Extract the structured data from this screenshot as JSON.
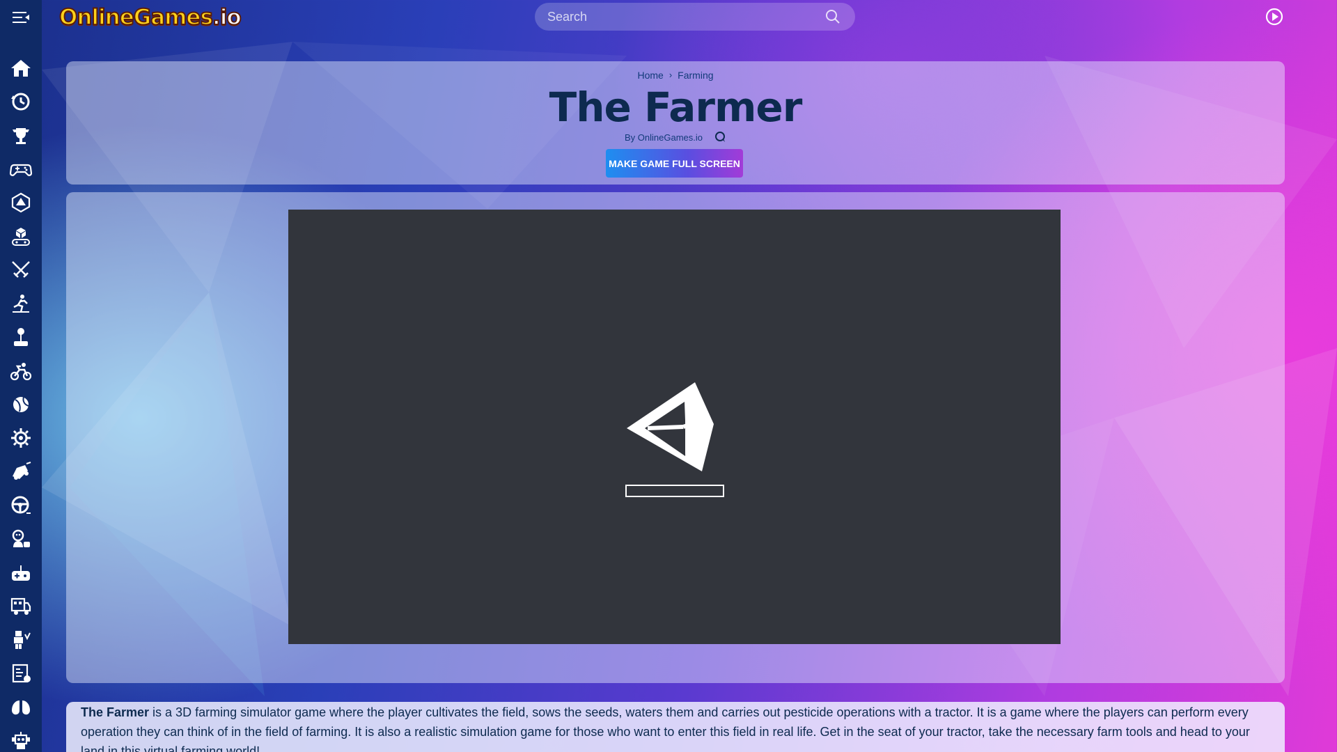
{
  "site": {
    "logo_main": "OnlineGames",
    "logo_suffix": ".io"
  },
  "search": {
    "placeholder": "Search",
    "value": ""
  },
  "sidebar": {
    "items": [
      {
        "icon": "home-icon"
      },
      {
        "icon": "history-icon"
      },
      {
        "icon": "trophy-icon"
      },
      {
        "icon": "gamepad-icon"
      },
      {
        "icon": "d20-icon"
      },
      {
        "icon": "joystick-cube-icon"
      },
      {
        "icon": "swords-icon"
      },
      {
        "icon": "stickman-icon"
      },
      {
        "icon": "arcade-stick-icon"
      },
      {
        "icon": "motorbike-icon"
      },
      {
        "icon": "ball-icon"
      },
      {
        "icon": "gear-icon"
      },
      {
        "icon": "car-crash-icon"
      },
      {
        "icon": "steering-wheel-icon"
      },
      {
        "icon": "kid-icon"
      },
      {
        "icon": "controller-icon"
      },
      {
        "icon": "truck-icon"
      },
      {
        "icon": "block-man-icon"
      },
      {
        "icon": "puzzle-icon"
      },
      {
        "icon": "lungs-icon"
      },
      {
        "icon": "robot-icon"
      }
    ]
  },
  "breadcrumb": {
    "home": "Home",
    "separator": "›",
    "category": "Farming"
  },
  "game": {
    "title": "The Farmer",
    "byline": "By OnlineGames.io",
    "fullscreen_label": "MAKE GAME FULL SCREEN",
    "loading_progress": 0
  },
  "description": {
    "game_name": "The Farmer",
    "text": " is a 3D farming simulator game where the player cultivates the field, sows the seeds, waters them and carries out pesticide operations with a tractor. It is a game where the players can perform every operation they can think of in the field of farming. It is also a realistic simulation game for those who want to enter this field in real life. Get in the seat of your tractor, take the necessary farm tools and head to your land in this virtual farming world!"
  },
  "colors": {
    "sidebar_bg": "#0f2a66",
    "title": "#0d2a4f",
    "game_bg": "#32353c",
    "button_start": "#1e8ef0",
    "button_end": "#a23bd8"
  }
}
